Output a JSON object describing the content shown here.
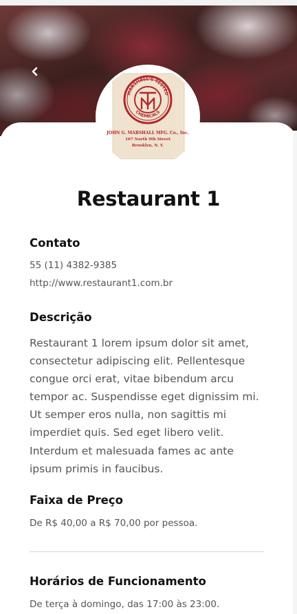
{
  "hero": {
    "image_label": "restaurant cover photo",
    "back_icon": "chevron-left-icon"
  },
  "logo": {
    "seal_top_text": "MARSHALL'S TESTED",
    "seal_bottom_text": "CHEMICALS",
    "company_line1": "JOHN G. MARSHALL MFG. Co., Inc.",
    "company_line2": "167 North 9th Street",
    "company_line3": "Brooklyn, N. Y."
  },
  "restaurant": {
    "name": "Restaurant 1"
  },
  "contact": {
    "heading": "Contato",
    "phone": "55 (11) 4382-9385",
    "website": "http://www.restaurant1.com.br"
  },
  "description": {
    "heading": "Descrição",
    "text": "Restaurant 1 lorem ipsum dolor sit amet, consectetur adipiscing elit. Pellentesque congue orci erat, vitae bibendum arcu tempor ac. Suspendisse eget dignissim mi. Ut semper eros nulla, non sagittis mi imperdiet quis. Sed eget libero velit. Interdum et malesuada fames ac ante ipsum primis in faucibus."
  },
  "price": {
    "heading": "Faixa de Preço",
    "text": "De R$ 40,00 a R$ 70,00 por pessoa."
  },
  "hours": {
    "heading": "Horários de Funcionamento",
    "text": "De terça à domingo, das 17:00 às 23:00."
  },
  "colors": {
    "text_primary": "#111111",
    "text_secondary": "#555555",
    "divider": "#d6d6d6",
    "logo_red": "#b3262b",
    "logo_bg": "#efe3cf"
  }
}
